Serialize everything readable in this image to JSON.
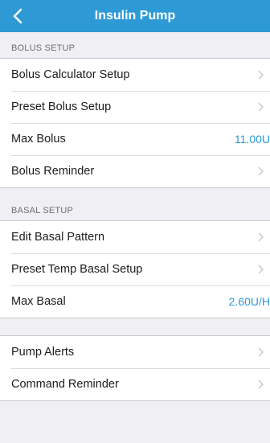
{
  "nav": {
    "title": "Insulin Pump",
    "back_icon": "chevron-left-icon"
  },
  "bolus_setup": {
    "header": "BOLUS SETUP",
    "items": [
      {
        "label": "Bolus Calculator Setup",
        "accessory": "chevron"
      },
      {
        "label": "Preset Bolus Setup",
        "accessory": "chevron"
      },
      {
        "label": "Max Bolus",
        "value": "11.00U"
      },
      {
        "label": "Bolus Reminder",
        "accessory": "chevron"
      }
    ]
  },
  "basal_setup": {
    "header": "BASAL SETUP",
    "items": [
      {
        "label": "Edit Basal Pattern",
        "accessory": "chevron"
      },
      {
        "label": "Preset Temp Basal Setup",
        "accessory": "chevron"
      },
      {
        "label": "Max Basal",
        "value": "2.60U/H"
      }
    ]
  },
  "alerts": {
    "items": [
      {
        "label": "Pump Alerts",
        "accessory": "chevron"
      },
      {
        "label": "Command Reminder",
        "accessory": "chevron"
      }
    ]
  },
  "colors": {
    "nav_background": "#2e9ad5",
    "accent": "#2e9ad5",
    "page_background": "#efeff4"
  }
}
